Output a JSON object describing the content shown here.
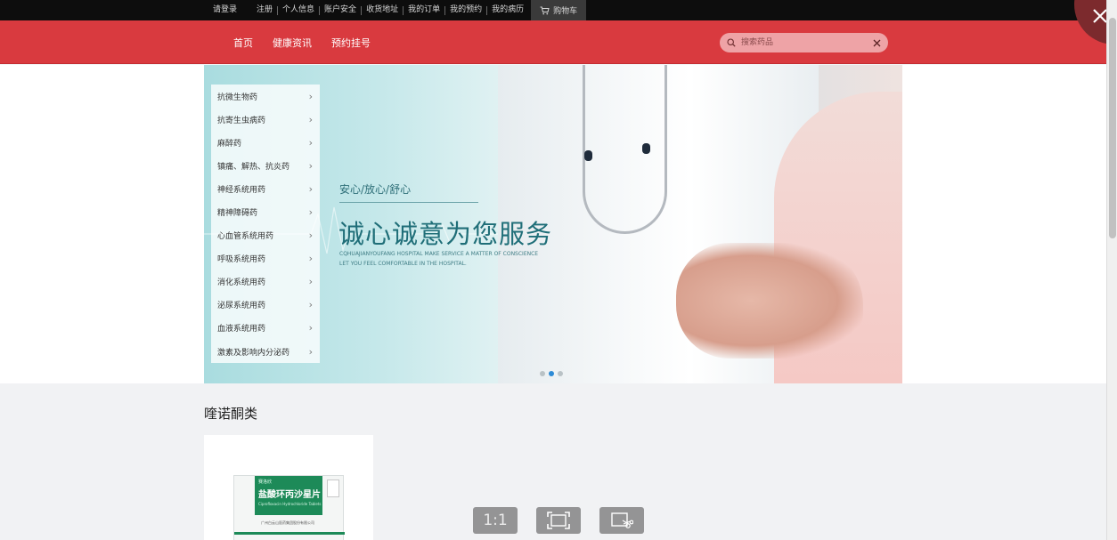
{
  "topbar": {
    "links": [
      "请登录",
      "注册",
      "个人信息",
      "账户安全",
      "收货地址",
      "我的订单",
      "我的预约",
      "我的病历"
    ],
    "cart_label": "购物车"
  },
  "nav": {
    "items": [
      "首页",
      "健康资讯",
      "预约挂号"
    ]
  },
  "search": {
    "placeholder": "搜索药品",
    "value": ""
  },
  "categories": [
    "抗微生物药",
    "抗寄生虫病药",
    "麻醉药",
    "镇痛、解热、抗炎药",
    "神经系统用药",
    "精神障碍药",
    "心血管系统用药",
    "呼吸系统用药",
    "消化系统用药",
    "泌尿系统用药",
    "血液系统用药",
    "激素及影响内分泌药"
  ],
  "banner": {
    "tagline": "安心/放心/舒心",
    "headline": "诚心诚意为您服务",
    "english_line1": "CQHUAJIANYOUFANG HOSPITAL MAKE SERVICE A MATTER OF CONSCIENCE",
    "english_line2": "LET YOU FEEL COMFORTABLE IN THE HOSPITAL.",
    "slide_count": 3,
    "active_slide": 2
  },
  "section": {
    "title": "喹诺酮类"
  },
  "product": {
    "brand": "赛洛欣",
    "name": "盐酸环丙沙星片",
    "subtitle": "Ciprofloxacin Hydrochloride Tablets",
    "maker": "广州白云山医药集团股份有限公司"
  },
  "viewer": {
    "zoom_label": "1:1"
  },
  "colors": {
    "nav_red": "#d93a3f",
    "topbar_black": "#0d0d0d",
    "banner_teal": "#1f6e78",
    "product_green": "#1d8a58",
    "active_dot": "#2d8bd6"
  }
}
